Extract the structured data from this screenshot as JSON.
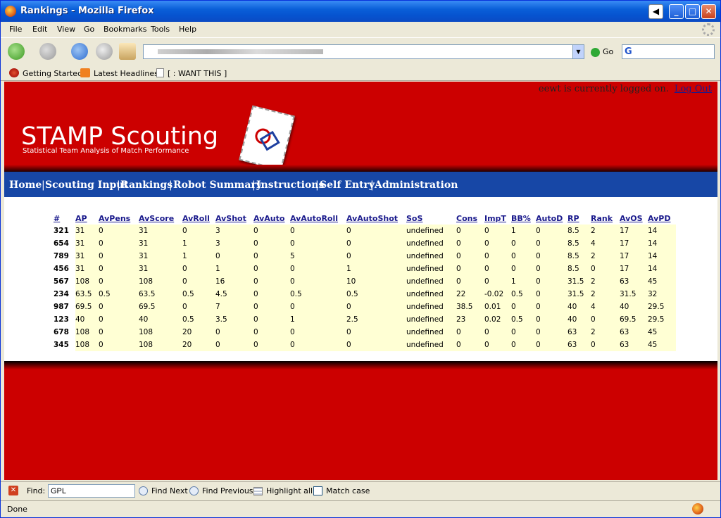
{
  "window": {
    "title": "Rankings - Mozilla Firefox"
  },
  "menu": {
    "items": [
      "File",
      "Edit",
      "View",
      "Go",
      "Bookmarks",
      "Tools",
      "Help"
    ]
  },
  "toolbar": {
    "go_label": "Go"
  },
  "bookmarks": {
    "items": [
      "Getting Started",
      "Latest Headlines",
      "[ : WANT THIS ]"
    ]
  },
  "page": {
    "login_text": "eewt is currently logged on.",
    "logout_label": "Log Out",
    "logo_title": "STAMP Scouting",
    "logo_subtitle": "Statistical Team Analysis of Match Performance",
    "nav": [
      "Home",
      "Scouting Input",
      "Rankings",
      "Robot Summary",
      "Instructions",
      "Self Entry",
      "Administration"
    ]
  },
  "table": {
    "headers": [
      "#",
      "AP",
      "AvPens",
      "AvScore",
      "AvRoll",
      "AvShot",
      "AvAuto",
      "AvAutoRoll",
      "AvAutoShot",
      "SoS",
      "Cons",
      "ImpT",
      "BB%",
      "AutoD",
      "RP",
      "Rank",
      "AvOS",
      "AvPD"
    ],
    "rows": [
      [
        "321",
        "31",
        "0",
        "31",
        "0",
        "3",
        "0",
        "0",
        "0",
        "undefined",
        "0",
        "0",
        "1",
        "0",
        "8.5",
        "2",
        "17",
        "14"
      ],
      [
        "654",
        "31",
        "0",
        "31",
        "1",
        "3",
        "0",
        "0",
        "0",
        "undefined",
        "0",
        "0",
        "0",
        "0",
        "8.5",
        "4",
        "17",
        "14"
      ],
      [
        "789",
        "31",
        "0",
        "31",
        "1",
        "0",
        "0",
        "5",
        "0",
        "undefined",
        "0",
        "0",
        "0",
        "0",
        "8.5",
        "2",
        "17",
        "14"
      ],
      [
        "456",
        "31",
        "0",
        "31",
        "0",
        "1",
        "0",
        "0",
        "1",
        "undefined",
        "0",
        "0",
        "0",
        "0",
        "8.5",
        "0",
        "17",
        "14"
      ],
      [
        "567",
        "108",
        "0",
        "108",
        "0",
        "16",
        "0",
        "0",
        "10",
        "undefined",
        "0",
        "0",
        "1",
        "0",
        "31.5",
        "2",
        "63",
        "45"
      ],
      [
        "234",
        "63.5",
        "0.5",
        "63.5",
        "0.5",
        "4.5",
        "0",
        "0.5",
        "0.5",
        "undefined",
        "22",
        "-0.02",
        "0.5",
        "0",
        "31.5",
        "2",
        "31.5",
        "32"
      ],
      [
        "987",
        "69.5",
        "0",
        "69.5",
        "0",
        "7",
        "0",
        "0",
        "0",
        "undefined",
        "38.5",
        "0.01",
        "0",
        "0",
        "40",
        "4",
        "40",
        "29.5"
      ],
      [
        "123",
        "40",
        "0",
        "40",
        "0.5",
        "3.5",
        "0",
        "1",
        "2.5",
        "undefined",
        "23",
        "0.02",
        "0.5",
        "0",
        "40",
        "0",
        "69.5",
        "29.5"
      ],
      [
        "678",
        "108",
        "0",
        "108",
        "20",
        "0",
        "0",
        "0",
        "0",
        "undefined",
        "0",
        "0",
        "0",
        "0",
        "63",
        "2",
        "63",
        "45"
      ],
      [
        "345",
        "108",
        "0",
        "108",
        "20",
        "0",
        "0",
        "0",
        "0",
        "undefined",
        "0",
        "0",
        "0",
        "0",
        "63",
        "0",
        "63",
        "45"
      ]
    ]
  },
  "findbar": {
    "label": "Find:",
    "value": "GPL",
    "next_label": "Find Next",
    "prev_label": "Find Previous",
    "highlight_label": "Highlight all",
    "matchcase_label": "Match case"
  },
  "status": {
    "text": "Done"
  },
  "colors": {
    "brand_red": "#cc0000",
    "nav_blue": "#1747a6",
    "row_bg": "#ffffd4",
    "link": "#1a1a8c"
  }
}
